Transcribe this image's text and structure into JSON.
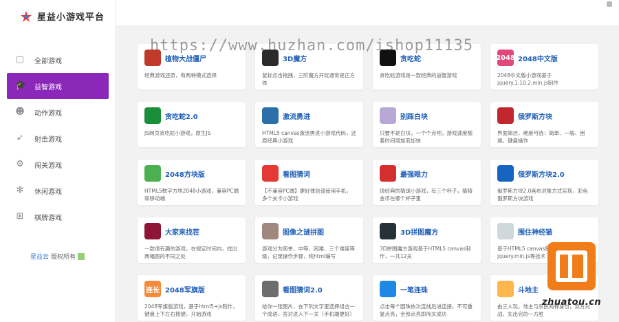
{
  "app": {
    "title": "星益小游戏平台"
  },
  "sidebar": {
    "items": [
      {
        "label": "全部游戏",
        "icon": "twitch-icon",
        "glyph": "▢",
        "active": false
      },
      {
        "label": "益智游戏",
        "icon": "graduation-cap-icon",
        "glyph": "🎓",
        "active": true
      },
      {
        "label": "动作游戏",
        "icon": "reddit-icon",
        "glyph": "☻",
        "active": false
      },
      {
        "label": "射击游戏",
        "icon": "rocket-icon",
        "glyph": "➶",
        "active": false
      },
      {
        "label": "闯关游戏",
        "icon": "steam-icon",
        "glyph": "⚙",
        "active": false
      },
      {
        "label": "休闲游戏",
        "icon": "pinwheel-icon",
        "glyph": "✻",
        "active": false
      },
      {
        "label": "棋牌游戏",
        "icon": "windows-icon",
        "glyph": "⊞",
        "active": false
      }
    ],
    "copyright_link": "星益云",
    "copyright_text": "版权所有"
  },
  "watermark": "https://www.huzhan.com/ishop11135",
  "corner_brand": "zhuatou.cn",
  "games": [
    {
      "title": "植物大战僵尸",
      "desc": "经典游戏还原，有两种模式选择",
      "thumb_color": "#c0392b",
      "thumb_text": ""
    },
    {
      "title": "3D魔方",
      "desc": "鼠标点击拖拽，三阶魔方开玩通常是正方体",
      "thumb_color": "#2b2b2b",
      "thumb_text": ""
    },
    {
      "title": "贪吃蛇",
      "desc": "贪吃蛇游戏是一款经典的益智游戏",
      "thumb_color": "#111111",
      "thumb_text": ""
    },
    {
      "title": "2048中文版",
      "desc": "2048中文版小游戏基于jquery.1.10.2.min.js制作",
      "thumb_color": "#e0497a",
      "thumb_text": "2048"
    },
    {
      "title": "贪吃蛇2.0",
      "desc": "JS网页贪吃蛇小游戏，原生JS",
      "thumb_color": "#1a8f3a",
      "thumb_text": ""
    },
    {
      "title": "激流勇进",
      "desc": "HTML5 canvas激流勇进小游戏代码，还原经典小游戏",
      "thumb_color": "#2d6fa8",
      "thumb_text": ""
    },
    {
      "title": "别踩白块",
      "desc": "只要不是白块，一个个点吧，游戏速度随着时间增加而加快",
      "thumb_color": "#b7a8d6",
      "thumb_text": ""
    },
    {
      "title": "俄罗斯方块",
      "desc": "界面简洁，难度可选：简单、一般、困难。键盘操作",
      "thumb_color": "#c2262f",
      "thumb_text": ""
    },
    {
      "title": "2048方块版",
      "desc": "HTML5数字方块2048小游戏，兼容PC端和移动端",
      "thumb_color": "#4caf50",
      "thumb_text": ""
    },
    {
      "title": "看图猜词",
      "desc": "【不兼容PC端】更好体验请使用手机，多个关卡小游戏",
      "thumb_color": "#e53935",
      "thumb_text": ""
    },
    {
      "title": "最强眼力",
      "desc": "很经典的猜球小游戏，有三个杯子，猜猜金币在哪个杯子里",
      "thumb_color": "#d32f2f",
      "thumb_text": ""
    },
    {
      "title": "俄罗斯方块2.0",
      "desc": "俄罗斯方块2.0画布对象方式实现，彩色俄罗斯方块游戏",
      "thumb_color": "#1565c0",
      "thumb_text": ""
    },
    {
      "title": "大家来找茬",
      "desc": "一款很有趣的游戏，在规定时间内，找出两幅图的不同之处",
      "thumb_color": "#8e1535",
      "thumb_text": ""
    },
    {
      "title": "图像之谜拼图",
      "desc": "游戏分为简单、中等、困难、三个难度等级，记录操作步骤，纯html编写",
      "thumb_color": "#a1887f",
      "thumb_text": ""
    },
    {
      "title": "3D拼图魔方",
      "desc": "3D拼图魔方游戏基于HTML5 canvas制作，一共12关",
      "thumb_color": "#263238",
      "thumb_text": ""
    },
    {
      "title": "围住神经猫",
      "desc": "基于HTML5 canvas制作，基于jquery.min.js等技术",
      "thumb_color": "#cfd8dc",
      "thumb_text": ""
    },
    {
      "title": "2048军旗版",
      "desc": "2048军旗版游戏，基于html5+js制作，键盘上下左右按键，开始游戏",
      "thumb_color": "#f48c3a",
      "thumb_text": "连长"
    },
    {
      "title": "看图猜词2.0",
      "desc": "给你一张图片，在下列文字里选择组合一个成语，答对进入下一关（手机端更好）",
      "thumb_color": "#6d6d6d",
      "thumb_text": ""
    },
    {
      "title": "一笔连珠",
      "desc": "点击每个圆珠依次连线后进连接，不可重复点亮，全部点亮即闯关成功",
      "thumb_color": "#1e88e5",
      "thumb_text": ""
    },
    {
      "title": "斗地主",
      "desc": "由三人玩，地主与农民两种身份，双方对战，先出完的一方胜",
      "thumb_color": "#ffb74d",
      "thumb_text": ""
    }
  ]
}
